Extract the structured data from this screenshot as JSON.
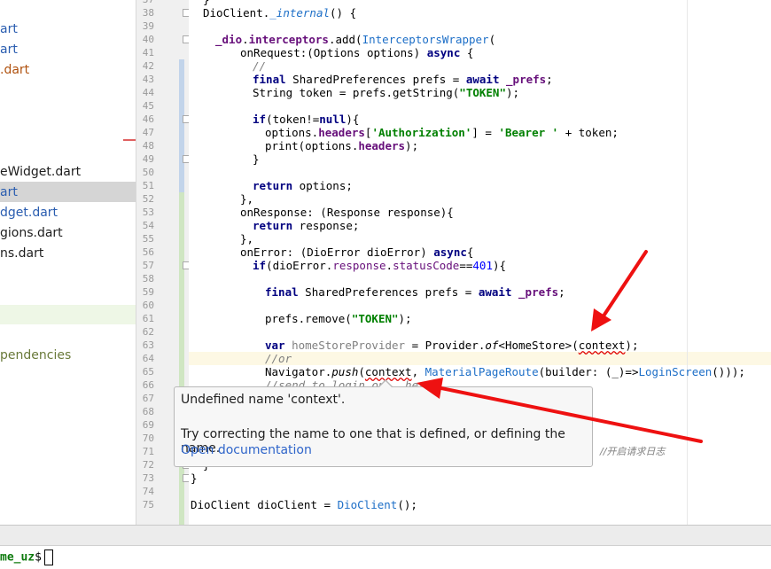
{
  "tree": {
    "items": [
      {
        "label": "art",
        "color": "#2a5db0"
      },
      {
        "label": "art",
        "color": "#2a5db0"
      },
      {
        "label": ".dart",
        "color": "#b0520f"
      },
      {
        "label": "eWidget.dart",
        "color": "#1e1e1e"
      },
      {
        "label": "art",
        "color": "#2a5db0"
      },
      {
        "label": "dget.dart",
        "color": "#2a5db0"
      },
      {
        "label": "gions.dart",
        "color": "#1e1e1e"
      },
      {
        "label": "ns.dart",
        "color": "#1e1e1e"
      },
      {
        "label": "pendencies",
        "color": "#6a7a3a"
      }
    ]
  },
  "editor": {
    "line_numbers": [
      "37",
      "38",
      "39",
      "40",
      "41",
      "42",
      "43",
      "44",
      "45",
      "46",
      "47",
      "48",
      "49",
      "50",
      "51",
      "52",
      "53",
      "54",
      "55",
      "56",
      "57",
      "58",
      "59",
      "60",
      "61",
      "62",
      "63",
      "64",
      "65",
      "66",
      "67",
      "68",
      "69",
      "70",
      "71",
      "72",
      "73",
      "74",
      "75"
    ],
    "code": {
      "l37": "}",
      "l38a": "DioClient.",
      "l38b": "_internal",
      "l38c": "() {",
      "l40a": "_dio",
      "l40b": ".",
      "l40c": "interceptors",
      "l40d": ".add(",
      "l40e": "InterceptorsWrapper",
      "l40f": "(",
      "l41a": "onRequest:(Options options) ",
      "l41b": "async",
      "l41c": " {",
      "l42": "//",
      "l43a": "final",
      "l43b": " SharedPreferences prefs = ",
      "l43c": "await",
      "l43d": " ",
      "l43e": "_prefs",
      "l43f": ";",
      "l44a": "String token = prefs.getString(",
      "l44b": "\"TOKEN\"",
      "l44c": ");",
      "l46a": "if",
      "l46b": "(token!=",
      "l46c": "null",
      "l46d": "){",
      "l47a": "options.",
      "l47b": "headers",
      "l47c": "[",
      "l47d": "'Authorization'",
      "l47e": "] = ",
      "l47f": "'Bearer '",
      "l47g": " + token;",
      "l48a": "print(options.",
      "l48b": "headers",
      "l48c": ");",
      "l49": "}",
      "l51a": "return",
      "l51b": " options;",
      "l52": "},",
      "l53": "onResponse: (Response response){",
      "l54a": "return",
      "l54b": " response;",
      "l55": "},",
      "l56a": "onError: (DioError dioError) ",
      "l56b": "async",
      "l56c": "{",
      "l57a": "if",
      "l57b": "(dioError.",
      "l57c": "response",
      "l57d": ".",
      "l57e": "statusCode",
      "l57f": "==",
      "l57g": "401",
      "l57h": "){",
      "l59a": "final",
      "l59b": " SharedPreferences prefs = ",
      "l59c": "await",
      "l59d": " ",
      "l59e": "_prefs",
      "l59f": ";",
      "l61a": "prefs.remove(",
      "l61b": "\"TOKEN\"",
      "l61c": ");",
      "l63a": "var",
      "l63b": " ",
      "l63c": "homeStoreProvider",
      "l63d": " = Provider.",
      "l63e": "of",
      "l63f": "<HomeStore>(",
      "l63g": "context",
      "l63h": ");",
      "l64": "//or",
      "l65a": "Navigator.",
      "l65b": "push",
      "l65c": "(",
      "l65d": "context",
      "l65e": ", ",
      "l65f": "MaterialPageRoute",
      "l65g": "(builder: (_)=>",
      "l65h": "LoginScreen",
      "l65i": "()));",
      "l66": "//send to login on   hes??",
      "l71": "//开启请求日志",
      "l72": "}",
      "l73": "}",
      "l75a": "DioClient dioClient = ",
      "l75b": "DioClient",
      "l75c": "();"
    }
  },
  "tooltip": {
    "title": "Undefined name 'context'.",
    "hint": "Try correcting the name to one that is defined, or defining the name.",
    "link": "Open documentation"
  },
  "terminal": {
    "prompt": "me_uz",
    "dollar": "$"
  },
  "colors": {
    "arrow": "#ee1111",
    "keyword": "#000080",
    "string": "#008000",
    "link": "#2f65ca"
  }
}
